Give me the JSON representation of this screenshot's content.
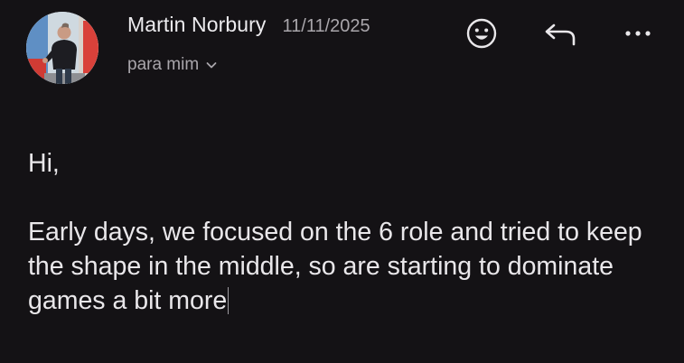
{
  "header": {
    "avatar_icon": "sender-avatar-photo",
    "sender_name": "Martin Norbury",
    "date": "11/11/2025",
    "recipient_label": "para mim",
    "recipient_chevron_icon": "chevron-down-icon"
  },
  "actions": {
    "react_icon": "smiley-icon",
    "reply_icon": "reply-arrow-icon",
    "more_icon": "more-horizontal-icon"
  },
  "message": {
    "greeting": "Hi,",
    "paragraph": "Early days, we focused on the 6 role and tried to keep the shape in the middle, so are starting to dominate games a bit more"
  },
  "colors": {
    "background": "#141215",
    "primary_text": "#e9e7ea",
    "secondary_text": "#a9a6ab"
  }
}
